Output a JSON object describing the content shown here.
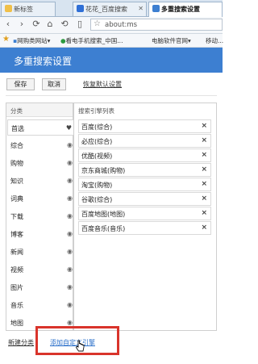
{
  "tabs": [
    {
      "label": "新标签",
      "active": false
    },
    {
      "label": "花花_百度搜索",
      "active": false
    },
    {
      "label": "多重搜索设置",
      "active": true
    }
  ],
  "address": {
    "url": "about:ms"
  },
  "bookmarks": [
    {
      "label": "网购类网站"
    },
    {
      "label": "看电手机搜索_中国..."
    },
    {
      "label": "电脑软件官网"
    },
    {
      "label": "移动..."
    }
  ],
  "page": {
    "title": "多重搜索设置"
  },
  "toolbar": {
    "save": "保存",
    "cancel": "取消",
    "reset": "恢复默认设置"
  },
  "categories": {
    "header": "分类",
    "items": [
      {
        "label": "首选",
        "icon": "heart"
      },
      {
        "label": "综合",
        "icon": "eye"
      },
      {
        "label": "购物",
        "icon": "eye"
      },
      {
        "label": "知识",
        "icon": "eye"
      },
      {
        "label": "词典",
        "icon": "eye"
      },
      {
        "label": "下载",
        "icon": "eye"
      },
      {
        "label": "博客",
        "icon": "eye"
      },
      {
        "label": "新闻",
        "icon": "eye"
      },
      {
        "label": "视频",
        "icon": "eye"
      },
      {
        "label": "图片",
        "icon": "eye"
      },
      {
        "label": "音乐",
        "icon": "eye"
      },
      {
        "label": "地图",
        "icon": "eye"
      }
    ]
  },
  "engines": {
    "header": "搜索引擎列表",
    "items": [
      {
        "label": "百度(综合)"
      },
      {
        "label": "必应(综合)"
      },
      {
        "label": "优酷(视频)"
      },
      {
        "label": "京东商城(购物)"
      },
      {
        "label": "淘宝(购物)"
      },
      {
        "label": "谷歌(综合)"
      },
      {
        "label": "百度地图(地图)"
      },
      {
        "label": "百度音乐(音乐)"
      }
    ]
  },
  "footer": {
    "new_category": "新建分类",
    "add_custom_engine": "添加自定义引擎"
  },
  "colors": {
    "accent": "#3d7fd1",
    "highlight": "#d9342b",
    "link": "#2a6fc9"
  }
}
